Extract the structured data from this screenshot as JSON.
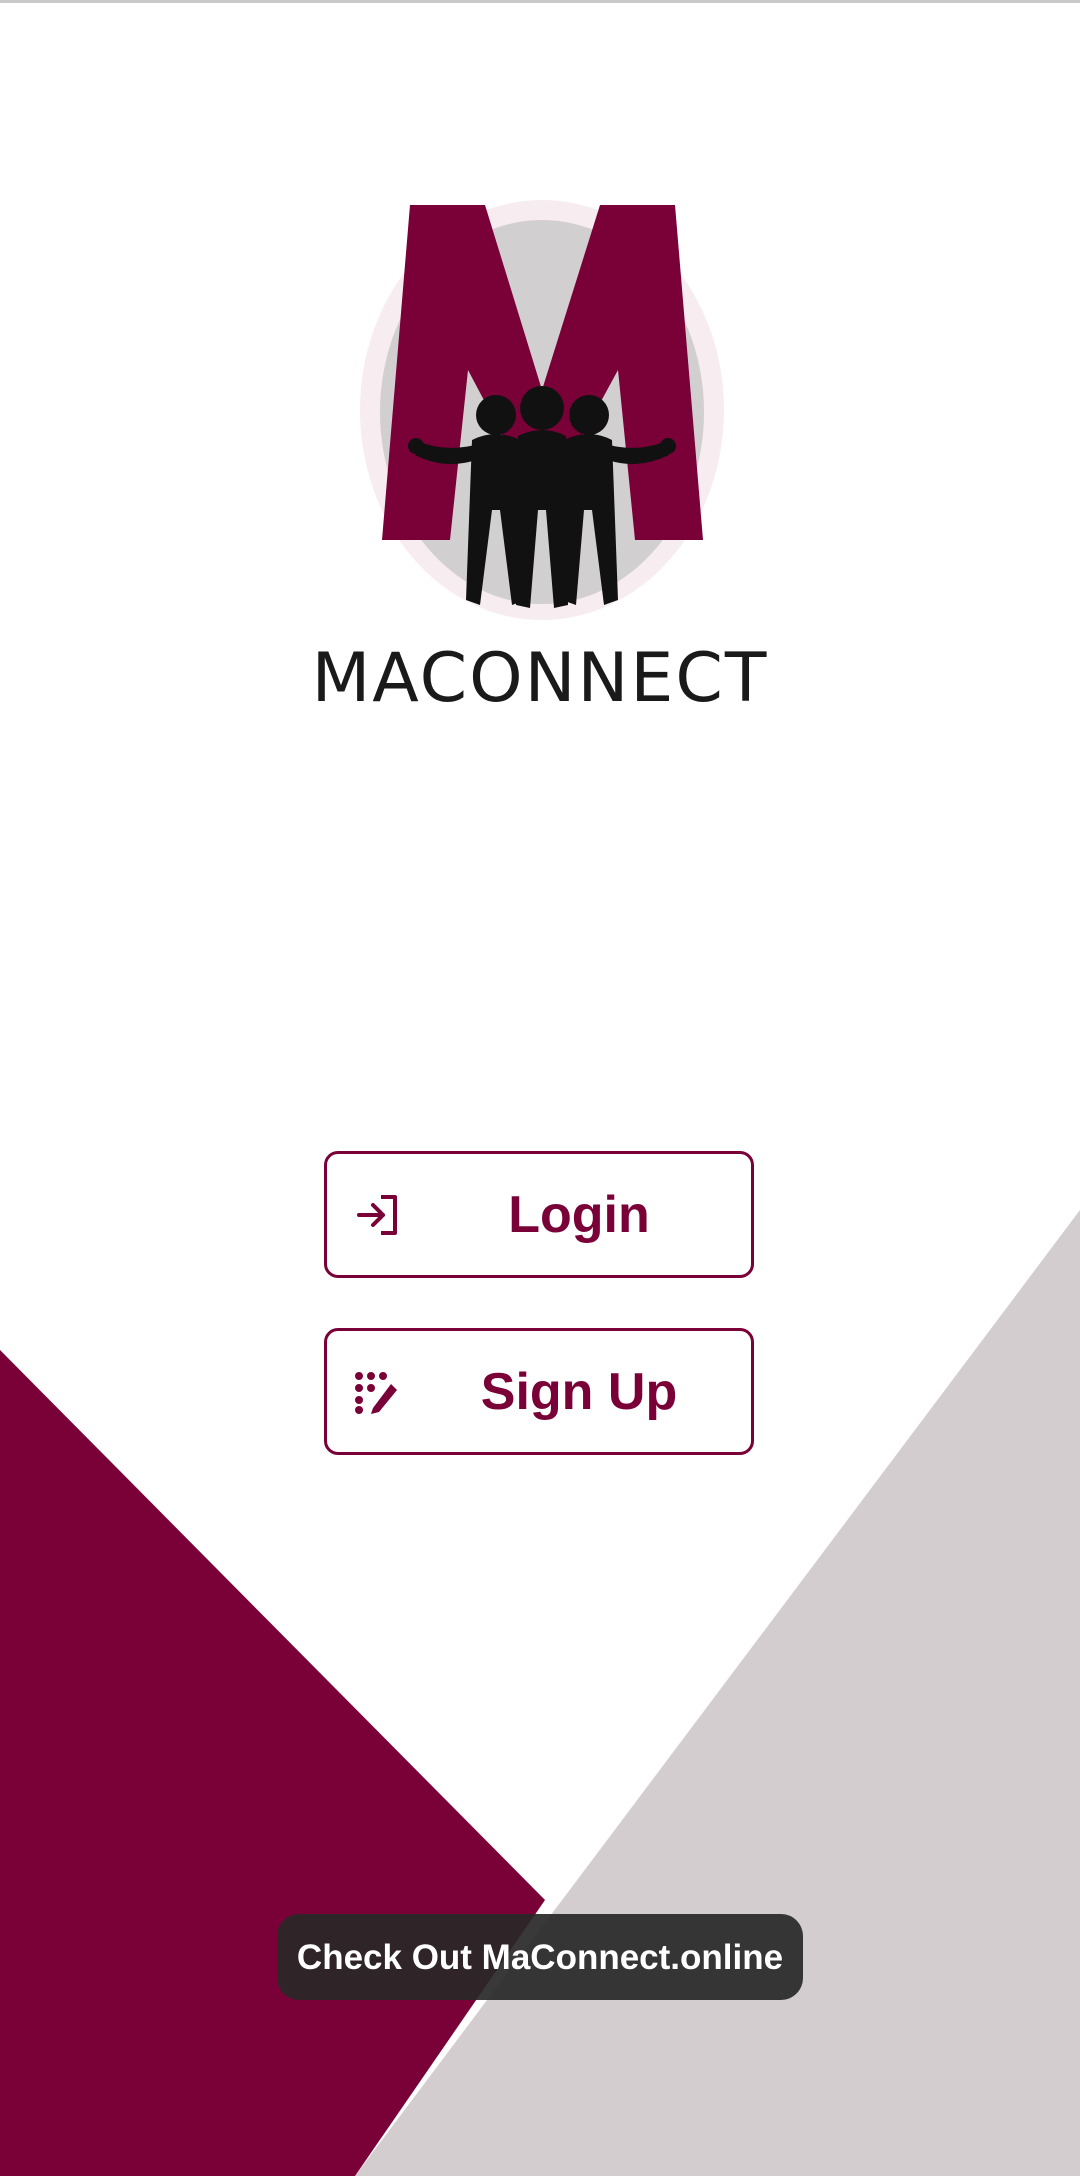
{
  "app": {
    "name": "MACONNECT"
  },
  "colors": {
    "brand": "#7a0038",
    "background": "#ffffff",
    "accent_gray": "#d3cdcf",
    "logo_circle": "#d2cfd0"
  },
  "logo": {
    "wordmark": "MACONNECT",
    "icon": "people-group-icon"
  },
  "buttons": {
    "login": {
      "label": "Login",
      "icon": "login-arrow-icon"
    },
    "signup": {
      "label": "Sign Up",
      "icon": "signup-dots-pen-icon"
    }
  },
  "toast": {
    "text": "Check Out MaConnect.online"
  }
}
